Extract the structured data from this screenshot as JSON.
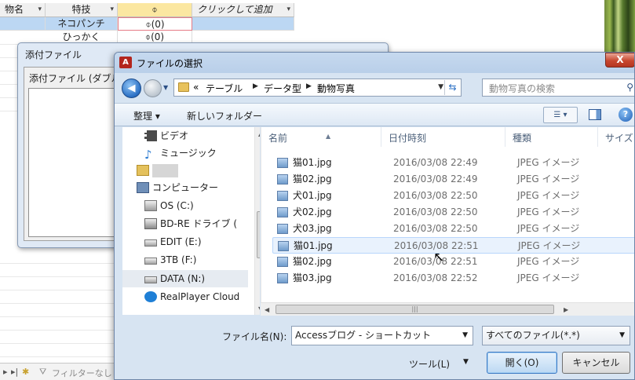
{
  "datasheet": {
    "columns": [
      "物名",
      "特技",
      "",
      "クリックして追加"
    ],
    "attachment_icon": "paperclip-icon",
    "rows": [
      {
        "skill": "ネコパンチ",
        "attachment": "(0)"
      },
      {
        "skill": "ひっかく",
        "attachment": "(0)"
      }
    ],
    "filter_label": "フィルターなし"
  },
  "attach_dialog": {
    "title": "添付ファイル",
    "list_label": "添付ファイル (ダブルクリックでファイルを開く)"
  },
  "file_dialog": {
    "title": "ファイルの選択",
    "app_icon_text": "A",
    "close_label": "X",
    "breadcrumb": [
      "«",
      "テーブル",
      "データ型",
      "動物写真"
    ],
    "search_placeholder": "動物写真の検索",
    "toolbar": {
      "organize": "整理 ▾",
      "new_folder": "新しいフォルダー"
    },
    "nav_items": [
      {
        "label": "ビデオ",
        "icon": "video-icon"
      },
      {
        "label": "ミュージック",
        "icon": "music-icon"
      },
      {
        "label": "",
        "icon": "user-folder-icon"
      },
      {
        "label": "コンピューター",
        "icon": "computer-icon"
      },
      {
        "label": "OS (C:)",
        "icon": "os-drive-icon"
      },
      {
        "label": "BD-RE ドライブ (",
        "icon": "optical-drive-icon"
      },
      {
        "label": "EDIT (E:)",
        "icon": "drive-icon"
      },
      {
        "label": "3TB (F:)",
        "icon": "drive-icon"
      },
      {
        "label": "DATA (N:)",
        "icon": "drive-icon"
      },
      {
        "label": "RealPlayer Cloud",
        "icon": "realplayer-icon"
      }
    ],
    "columns": {
      "name": "名前",
      "date": "日付時刻",
      "type": "種類",
      "size": "サイズ"
    },
    "files": [
      {
        "name": "猫01.jpg",
        "date": "2016/03/08 22:49",
        "type": "JPEG イメージ"
      },
      {
        "name": "猫02.jpg",
        "date": "2016/03/08 22:49",
        "type": "JPEG イメージ"
      },
      {
        "name": "犬01.jpg",
        "date": "2016/03/08 22:50",
        "type": "JPEG イメージ"
      },
      {
        "name": "犬02.jpg",
        "date": "2016/03/08 22:50",
        "type": "JPEG イメージ"
      },
      {
        "name": "犬03.jpg",
        "date": "2016/03/08 22:50",
        "type": "JPEG イメージ"
      },
      {
        "name": "猫01.jpg",
        "date": "2016/03/08 22:51",
        "type": "JPEG イメージ"
      },
      {
        "name": "猫02.jpg",
        "date": "2016/03/08 22:51",
        "type": "JPEG イメージ"
      },
      {
        "name": "猫03.jpg",
        "date": "2016/03/08 22:52",
        "type": "JPEG イメージ"
      }
    ],
    "filename_label": "ファイル名(N):",
    "filename_value": "Accessブログ - ショートカット",
    "filetype_value": "すべてのファイル(*.*)",
    "tools_label": "ツール(L)",
    "open_label": "開く(O)",
    "cancel_label": "キャンセル"
  }
}
